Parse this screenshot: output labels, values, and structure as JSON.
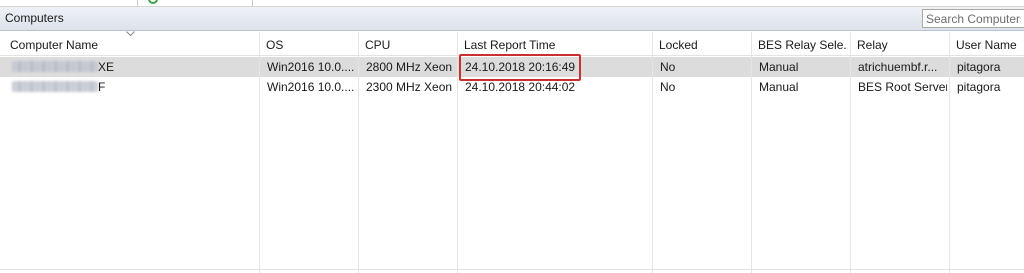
{
  "panel": {
    "title": "Computers"
  },
  "search": {
    "placeholder": "Search Computers"
  },
  "columns": [
    "Computer Name",
    "OS",
    "CPU",
    "Last Report Time",
    "Locked",
    "BES Relay Sele...",
    "Relay",
    "User Name"
  ],
  "rows": [
    {
      "name_suffix": "XE",
      "os": "Win2016 10.0....",
      "cpu": "2800 MHz Xeon",
      "last_report": "24.10.2018 20:16:49",
      "locked": "No",
      "relay_selection": "Manual",
      "relay": "atrichuembf.r...",
      "user": "pitagora",
      "selected": true
    },
    {
      "name_suffix": "F",
      "os": "Win2016 10.0....",
      "cpu": "2300 MHz Xeon",
      "last_report": "24.10.2018 20:44:02",
      "locked": "No",
      "relay_selection": "Manual",
      "relay": "BES Root Server",
      "user": "pitagora",
      "selected": false
    }
  ],
  "colors": {
    "selection": "#dcdcdc",
    "highlight_border": "#c8312f",
    "header_gradient_top": "#eef2f7",
    "header_gradient_bottom": "#dde3eb"
  },
  "icons": [
    "sort-descending-icon",
    "green-status-icon"
  ]
}
